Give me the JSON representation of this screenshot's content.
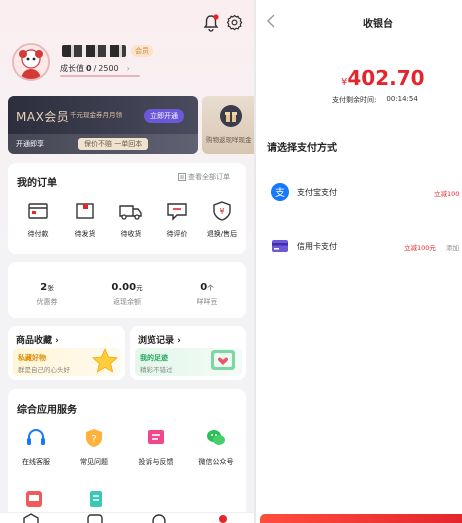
{
  "profile": {
    "name_mask": "",
    "badge": "会员",
    "growth_label": "成长值",
    "growth_current": "0",
    "growth_sep": "/",
    "growth_total": "2500",
    "growth_arrow": "›"
  },
  "vip_banner": {
    "title": "MAX会员",
    "tagline": "千元现金券月月领",
    "open_button": "立即开通",
    "sub_left": "开通即享",
    "sub_right": "保价不赔 一单回本",
    "side_text": "购物返现咩现金"
  },
  "orders": {
    "title": "我的订单",
    "view_all": "查看全部订单",
    "items": [
      {
        "label": "待付款"
      },
      {
        "label": "待发货"
      },
      {
        "label": "待收货"
      },
      {
        "label": "待评价"
      },
      {
        "label": "退换/售后"
      }
    ]
  },
  "assets": {
    "items": [
      {
        "value": "2",
        "unit": "张",
        "label": "优惠券"
      },
      {
        "value": "0.00",
        "unit": "元",
        "label": "返现余额"
      },
      {
        "value": "0",
        "unit": "个",
        "label": "咩咩豆"
      }
    ]
  },
  "favorites": {
    "title": "商品收藏 ›",
    "subtitle": "私藏好物",
    "desc": "群是自己的心头好"
  },
  "history": {
    "title": "浏览记录 ›",
    "subtitle": "我的足迹",
    "desc": "精彩不错过"
  },
  "services": {
    "title": "综合应用服务",
    "items": [
      {
        "label": "在线客服"
      },
      {
        "label": "常见问题"
      },
      {
        "label": "投诉与反馈"
      },
      {
        "label": "微信公众号"
      }
    ]
  },
  "checkout": {
    "title": "收银台",
    "currency": "¥",
    "amount": "402.70",
    "timer_label": "支付剩余时间:",
    "timer_value": "00:14:54",
    "method_prompt": "请选择支付方式",
    "methods": [
      {
        "name": "支付宝支付",
        "promo": "立减100"
      },
      {
        "name": "信用卡支付",
        "promo": "立减100元",
        "extra": "添加"
      }
    ]
  },
  "colors": {
    "accent_red": "#e3262c",
    "alipay_blue": "#1677ff",
    "card_purple": "#6b57d8",
    "vip_dark": "#3a3b4c",
    "vip_gold": "#c9a27a"
  }
}
